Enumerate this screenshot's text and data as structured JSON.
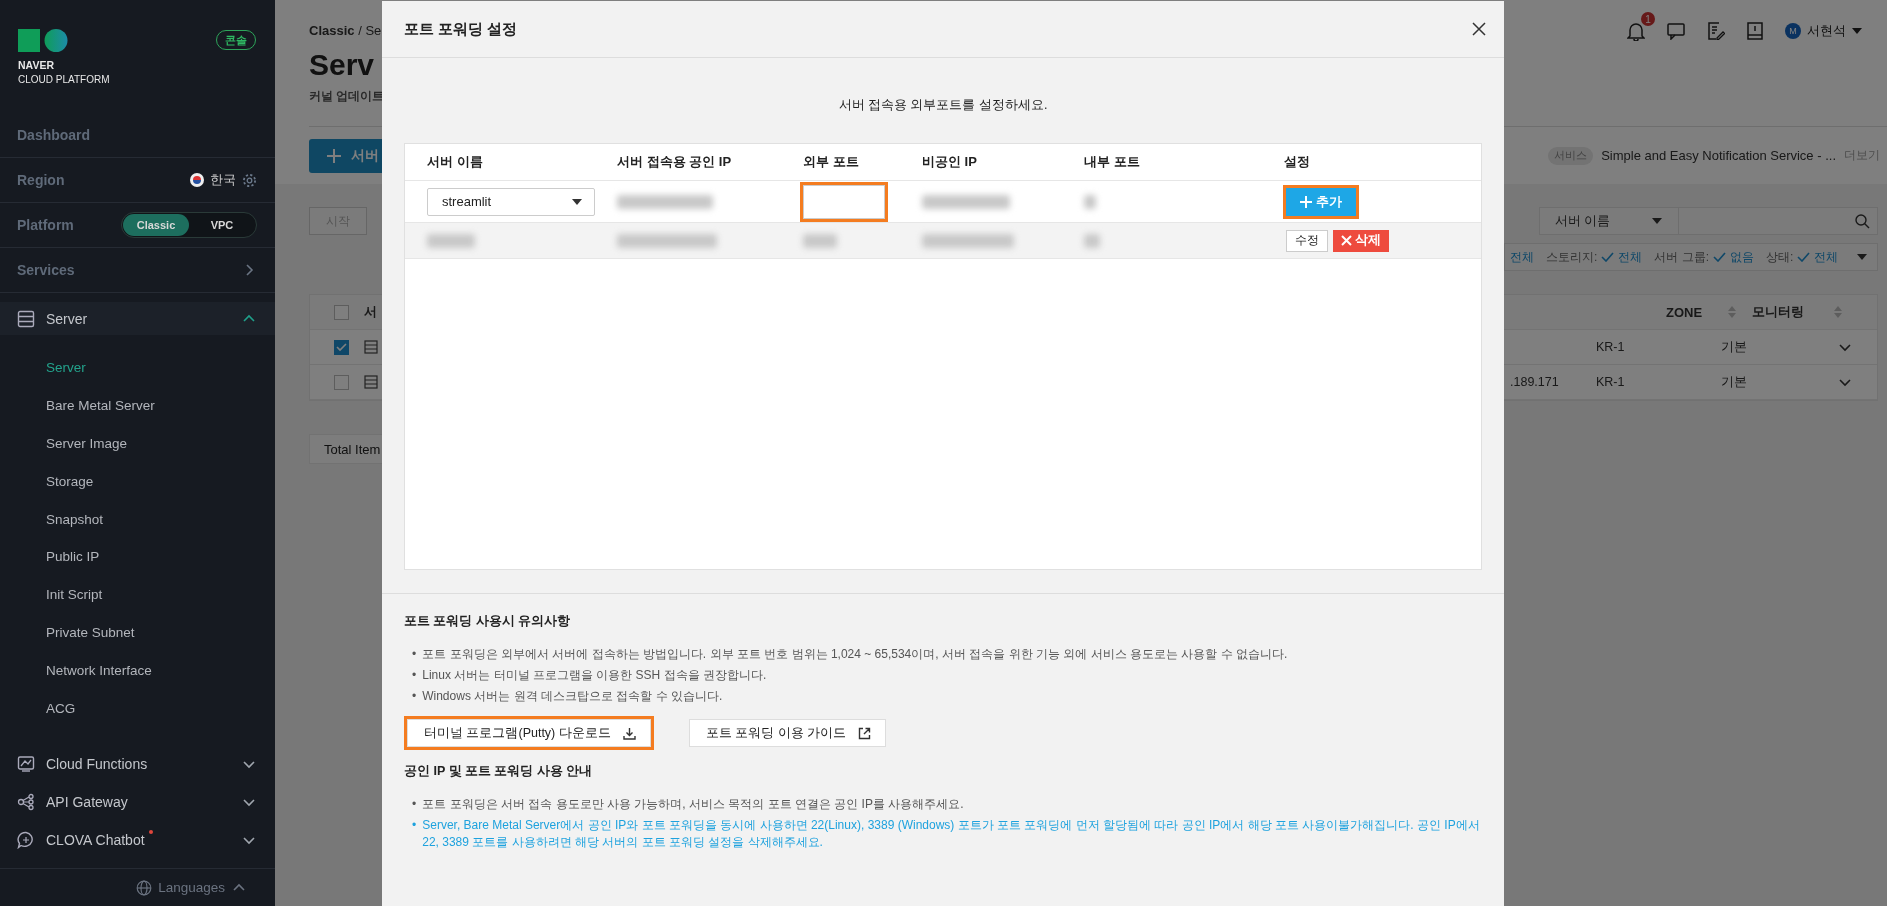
{
  "sidebar": {
    "logo": {
      "line1": "NAVER",
      "line2": "CLOUD PLATFORM"
    },
    "badge": "콘솔",
    "dashboard": "Dashboard",
    "region": {
      "label": "Region",
      "value": "한국"
    },
    "platform": {
      "label": "Platform",
      "options": [
        {
          "label": "Classic",
          "selected": true
        },
        {
          "label": "VPC",
          "selected": false
        }
      ]
    },
    "services": "Services",
    "groups": [
      {
        "label": "Server",
        "expanded": true,
        "new": false,
        "children": [
          {
            "label": "Server",
            "selected": true
          },
          {
            "label": "Bare Metal Server",
            "selected": false
          },
          {
            "label": "Server Image",
            "selected": false
          },
          {
            "label": "Storage",
            "selected": false
          },
          {
            "label": "Snapshot",
            "selected": false
          },
          {
            "label": "Public IP",
            "selected": false
          },
          {
            "label": "Init Script",
            "selected": false
          },
          {
            "label": "Private Subnet",
            "selected": false
          },
          {
            "label": "Network Interface",
            "selected": false
          },
          {
            "label": "ACG",
            "selected": false
          }
        ]
      },
      {
        "label": "Cloud Functions",
        "expanded": false,
        "new": false
      },
      {
        "label": "API Gateway",
        "expanded": false,
        "new": false
      },
      {
        "label": "CLOVA Chatbot",
        "expanded": false,
        "new": true
      }
    ],
    "languages": "Languages"
  },
  "page": {
    "breadcrumb": "**Classic** / Se",
    "title": "Serv",
    "subtitle": "커널 업데이트",
    "create_button": "서버",
    "notification_count": "1",
    "user": {
      "initial": "M",
      "name": "서현석"
    },
    "service": {
      "tag": "서비스",
      "text": "Simple and Easy Notification Service - ...",
      "more": "더보기"
    },
    "status_tab": "시작",
    "search": {
      "select": "서버 이름"
    },
    "filters": [
      {
        "value": "전체"
      },
      {
        "label": "스토리지:",
        "value": "전체"
      },
      {
        "label": "서버 그룹:",
        "value": "없음"
      },
      {
        "label": "상태:",
        "value": "전체"
      }
    ],
    "table": {
      "select_all_checked": false,
      "column_left": "서",
      "columns_right": [
        "ZONE",
        "모니터링"
      ],
      "rows": [
        {
          "checked": true,
          "zone": "KR-1",
          "monitoring": "기본"
        },
        {
          "checked": false,
          "ip": ".189.171",
          "zone": "KR-1",
          "monitoring": "기본"
        }
      ]
    },
    "total": "Total Item"
  },
  "modal": {
    "title": "포트 포워딩 설정",
    "instruction": "서버 접속용 외부포트를 설정하세요.",
    "columns": [
      "서버 이름",
      "서버 접속용 공인 IP",
      "외부 포트",
      "비공인 IP",
      "내부 포트",
      "설정"
    ],
    "rows": [
      {
        "cells": [
          {
            "kind": "select",
            "value": "streamlit"
          },
          {
            "kind": "blurred"
          },
          {
            "kind": "input",
            "highlighted": true
          },
          {
            "kind": "blurred"
          },
          {
            "kind": "blurred"
          }
        ],
        "actions": [
          {
            "kind": "add",
            "label": "추가",
            "highlighted": true
          }
        ]
      },
      {
        "cells": [
          {
            "kind": "blurred"
          },
          {
            "kind": "blurred"
          },
          {
            "kind": "blurred"
          },
          {
            "kind": "blurred"
          },
          {
            "kind": "blurred"
          }
        ],
        "actions": [
          {
            "kind": "edit",
            "label": "수정",
            "highlighted": false
          },
          {
            "kind": "delete",
            "label": "삭제",
            "highlighted": false
          }
        ]
      }
    ],
    "notes": {
      "title": "포트 포워딩 사용시 유의사항",
      "marker": "•",
      "items": [
        "포트 포워딩은 외부에서 서버에 접속하는 방법입니다. 외부 포트 번호 범위는 1,024 ~ 65,534이며, 서버 접속을 위한 기능 외에 서비스 용도로는 사용할 수 없습니다.",
        "Linux 서버는 터미널 프로그램을 이용한 SSH 접속을 권장합니다.",
        "Windows 서버는 원격 데스크탑으로 접속할 수 있습니다."
      ]
    },
    "buttons": [
      {
        "label": "터미널 프로그램(Putty) 다운로드",
        "kind": "download",
        "highlighted": true
      },
      {
        "label": "포트 포워딩 이용 가이드",
        "kind": "guide",
        "highlighted": false
      }
    ],
    "guide": {
      "title": "공인 IP 및 포트 포워딩 사용 안내",
      "marker": "•",
      "items": [
        {
          "text": "포트 포워딩은 서버 접속 용도로만 사용 가능하며, 서비스 목적의 포트 연결은 공인 IP를 사용해주세요.",
          "emphasis": false
        },
        {
          "text": "Server, Bare Metal Server에서 공인 IP와 포트 포워딩을 동시에 사용하면 22(Linux), 3389 (Windows) 포트가 포트 포워딩에 먼저 할당됨에 따라 공인 IP에서 해당 포트 사용이불가해집니다. 공인 IP에서 22, 3389 포트를 사용하려면 해당 서버의 포트 포워딩 설정을 삭제해주세요.",
          "emphasis": true
        }
      ]
    }
  }
}
